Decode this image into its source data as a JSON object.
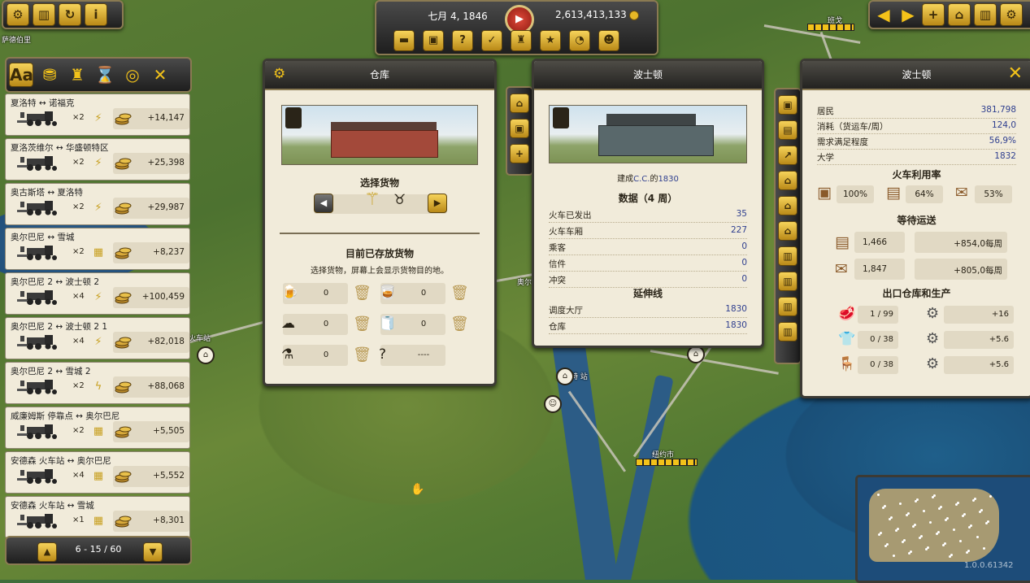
{
  "map": {
    "labels": {
      "sadebo": "萨德伯里",
      "bange": "班戈",
      "huochezhan": "火车站",
      "aoer": "奥尔",
      "maisite": "麦斯特 站",
      "niuyue": "纽约市"
    }
  },
  "top_left": {
    "buttons": [
      "settings-icon",
      "factory-icon",
      "contracts-icon",
      "info-icon"
    ]
  },
  "top_bar": {
    "date": "七月 4, 1846",
    "money": "2,613,413,133",
    "buttons": [
      "trains-icon",
      "stations-icon",
      "help-icon",
      "checklist-icon",
      "hat-icon",
      "bottles-icon",
      "speed-icon",
      "people-icon"
    ]
  },
  "top_right": {
    "buttons": [
      "arrow-left",
      "arrow-right",
      "build-track",
      "build-station",
      "build-factory",
      "settings-gear"
    ]
  },
  "route_panel": {
    "tabs": [
      "Aa",
      "coins",
      "train",
      "hourglass",
      "compass",
      "close"
    ],
    "routes": [
      {
        "name": "夏洛特 ↔ 诺福克",
        "mult": "×2",
        "stat": "⚡",
        "profit": "+14,147"
      },
      {
        "name": "夏洛茨维尔 ↔ 华盛顿特区",
        "mult": "×2",
        "stat": "⚡",
        "profit": "+25,398"
      },
      {
        "name": "奥古斯塔 ↔ 夏洛特",
        "mult": "×2",
        "stat": "⚡",
        "profit": "+29,987"
      },
      {
        "name": "奥尔巴尼 ↔ 雪城",
        "mult": "×2",
        "stat": "▦",
        "profit": "+8,237"
      },
      {
        "name": "奥尔巴尼 2 ↔ 波士顿 2",
        "mult": "×4",
        "stat": "⚡",
        "profit": "+100,459"
      },
      {
        "name": "奥尔巴尼 2 ↔ 波士顿 2 1",
        "mult": "×4",
        "stat": "⚡",
        "profit": "+82,018"
      },
      {
        "name": "奥尔巴尼 2 ↔ 雪城 2",
        "mult": "×2",
        "stat": "ϟ",
        "profit": "+88,068"
      },
      {
        "name": "威廉姆斯 停靠点 ↔ 奥尔巴尼",
        "mult": "×2",
        "stat": "▦",
        "profit": "+5,505"
      },
      {
        "name": "安德森 火车站 ↔ 奥尔巴尼",
        "mult": "×4",
        "stat": "▦",
        "profit": "+5,552"
      },
      {
        "name": "安德森 火车站 ↔ 雪城",
        "mult": "×1",
        "stat": "▦",
        "profit": "+8,301"
      }
    ],
    "pager": "6 - 15 / 60"
  },
  "warehouse": {
    "title": "仓库",
    "select_goods": "选择货物",
    "stored_title": "目前已存放货物",
    "stored_hint": "选择货物，屏幕上会显示货物目的地。",
    "goods": [
      {
        "icon": "beer-icon",
        "glyph": "🍺",
        "value": "0"
      },
      {
        "icon": "whiskey-icon",
        "glyph": "🥃",
        "value": "0"
      },
      {
        "icon": "cotton-icon",
        "glyph": "☁",
        "value": "0"
      },
      {
        "icon": "paper-roll-icon",
        "glyph": "🧻",
        "value": "0"
      },
      {
        "icon": "chemicals-icon",
        "glyph": "⚗",
        "value": "0"
      },
      {
        "icon": "unknown-icon",
        "glyph": "?",
        "value": "----"
      }
    ]
  },
  "station": {
    "title": "波士顿",
    "built_by_prefix": "建成",
    "built_by_name": "C.C.",
    "built_by_mid": "的",
    "built_year": "1830",
    "stats_title": "数据（4 周）",
    "stats": [
      {
        "k": "火车已发出",
        "v": "35"
      },
      {
        "k": "火车车厢",
        "v": "227"
      },
      {
        "k": "乘客",
        "v": "0"
      },
      {
        "k": "信件",
        "v": "0"
      },
      {
        "k": "冲突",
        "v": "0"
      }
    ],
    "ext_title": "延伸线",
    "extensions": [
      {
        "k": "调度大厅",
        "v": "1830"
      },
      {
        "k": "仓库",
        "v": "1830"
      }
    ]
  },
  "city": {
    "title": "波士顿",
    "info": [
      {
        "k": "居民",
        "v": "381,798"
      },
      {
        "k": "消耗（货运车/周）",
        "v": "124,0"
      },
      {
        "k": "需求满足程度",
        "v": "56,9%"
      },
      {
        "k": "大学",
        "v": "1832"
      }
    ],
    "util_title": "火车利用率",
    "util": [
      {
        "icon": "crate-icon",
        "glyph": "▣",
        "v": "100%"
      },
      {
        "icon": "luggage-icon",
        "glyph": "▤",
        "v": "64%"
      },
      {
        "icon": "mail-icon",
        "glyph": "✉",
        "v": "53%"
      }
    ],
    "wait_title": "等待运送",
    "waiting": [
      {
        "icon": "luggage-icon",
        "glyph": "▤",
        "count": "1,466",
        "rate": "+854,0每周"
      },
      {
        "icon": "mail-icon",
        "glyph": "✉",
        "count": "1,847",
        "rate": "+805,0每周"
      }
    ],
    "prod_title": "出口仓库和生产",
    "production": [
      {
        "icon": "meat-icon",
        "glyph": "🥩",
        "stock": "1 / 99",
        "rate": "+16"
      },
      {
        "icon": "clothes-icon",
        "glyph": "👕",
        "stock": "0 / 38",
        "rate": "+5.6"
      },
      {
        "icon": "furniture-icon",
        "glyph": "🪑",
        "stock": "0 / 38",
        "rate": "+5.6"
      }
    ]
  },
  "version": "1.0.0.61342",
  "colors": {
    "gold": "#f2c21a",
    "panel": "#f1ebda",
    "value_blue": "#2f3f8f"
  }
}
